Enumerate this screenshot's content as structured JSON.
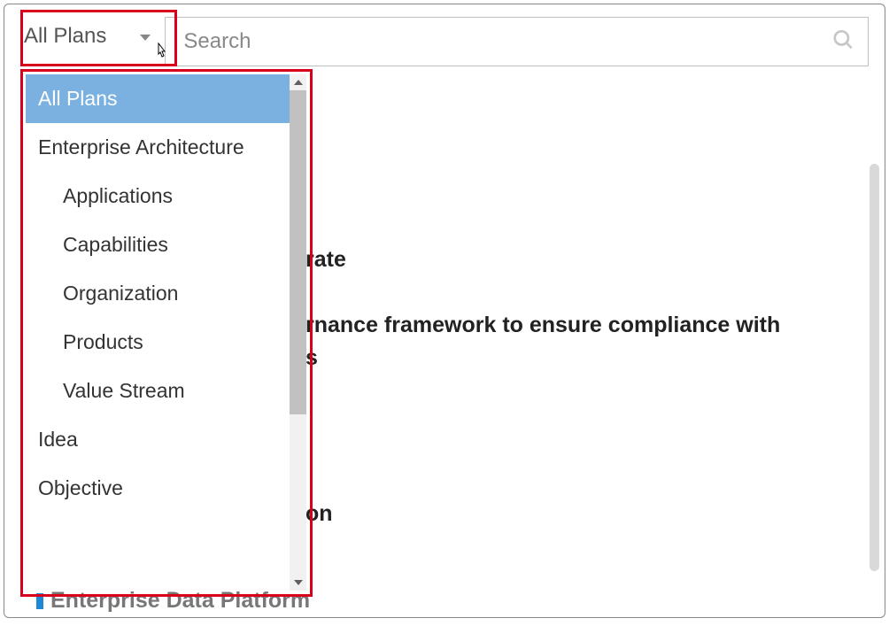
{
  "filter": {
    "trigger_label": "All Plans",
    "options": [
      {
        "label": "All Plans",
        "indent": 0,
        "selected": true
      },
      {
        "label": "Enterprise Architecture",
        "indent": 0,
        "selected": false
      },
      {
        "label": "Applications",
        "indent": 1,
        "selected": false
      },
      {
        "label": "Capabilities",
        "indent": 1,
        "selected": false
      },
      {
        "label": "Organization",
        "indent": 1,
        "selected": false
      },
      {
        "label": "Products",
        "indent": 1,
        "selected": false
      },
      {
        "label": "Value Stream",
        "indent": 1,
        "selected": false
      },
      {
        "label": "Idea",
        "indent": 0,
        "selected": false
      },
      {
        "label": "Objective",
        "indent": 0,
        "selected": false
      }
    ]
  },
  "search": {
    "placeholder": "Search",
    "value": ""
  },
  "content": {
    "fragment1_suffix": "rate",
    "fragment2_line1_suffix": "rnance framework to ensure compliance with",
    "fragment2_line2_suffix": "s",
    "fragment3_suffix": "on",
    "bottom_item": "Enterprise Data Platform"
  }
}
